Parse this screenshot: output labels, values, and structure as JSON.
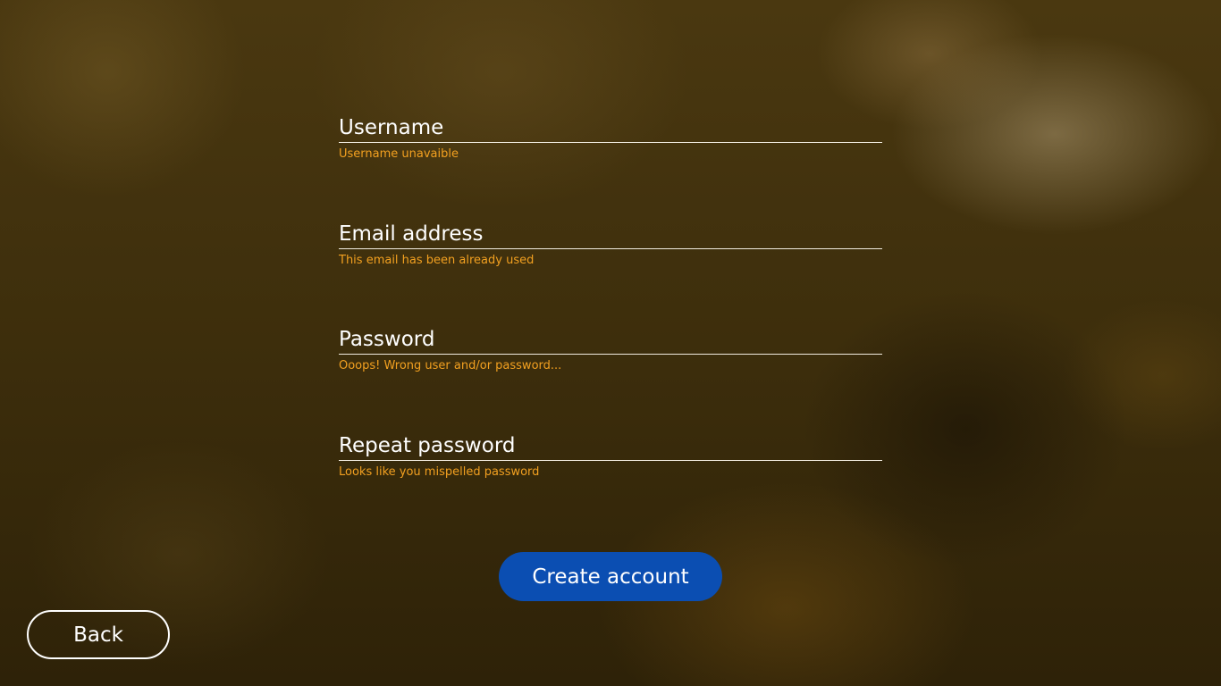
{
  "form": {
    "fields": [
      {
        "label": "Username",
        "value": "",
        "error": "Username unavaible"
      },
      {
        "label": "Email address",
        "value": "",
        "error": "This email has been already used"
      },
      {
        "label": "Password",
        "value": "",
        "error": "Ooops! Wrong user and/or password..."
      },
      {
        "label": "Repeat password",
        "value": "",
        "error": "Looks like you mispelled password"
      }
    ],
    "create_button": "Create account"
  },
  "navigation": {
    "back_button": "Back"
  },
  "colors": {
    "error_text": "#f2a020",
    "primary_button": "#0b4eb2",
    "text": "#ffffff"
  }
}
